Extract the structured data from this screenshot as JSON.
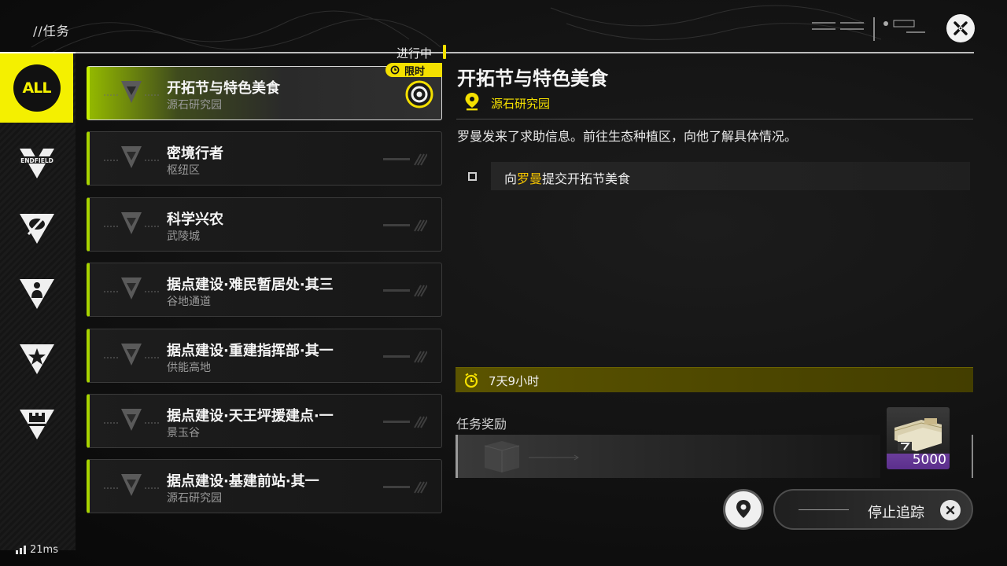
{
  "header": {
    "breadcrumb": "//任务"
  },
  "categories": [
    {
      "label": "ALL",
      "icon": "all-icon",
      "active": true
    },
    {
      "label": "ENDFIELD",
      "icon": "endfield-icon",
      "active": false
    },
    {
      "label": "",
      "icon": "blade-icon",
      "active": false
    },
    {
      "label": "",
      "icon": "person-icon",
      "active": false
    },
    {
      "label": "",
      "icon": "star-icon",
      "active": false
    },
    {
      "label": "",
      "icon": "building-icon",
      "active": false
    }
  ],
  "status": {
    "in_progress": "进行中",
    "limited": "限时"
  },
  "missions": [
    {
      "title": "开拓节与特色美食",
      "region": "源石研究园",
      "active": true
    },
    {
      "title": "密境行者",
      "region": "枢纽区",
      "active": false
    },
    {
      "title": "科学兴农",
      "region": "武陵城",
      "active": false
    },
    {
      "title": "据点建设·难民暂居处·其三",
      "region": "谷地通道",
      "active": false
    },
    {
      "title": "据点建设·重建指挥部·其一",
      "region": "供能高地",
      "active": false
    },
    {
      "title": "据点建设·天王坪援建点·一",
      "region": "景玉谷",
      "active": false
    },
    {
      "title": "据点建设·基建前站·其一",
      "region": "源石研究园",
      "active": false
    }
  ],
  "detail": {
    "title": "开拓节与特色美食",
    "location": "源石研究园",
    "description": "罗曼发来了求助信息。前往生态种植区，向他了解具体情况。",
    "objective": {
      "prefix": "向",
      "highlight": "罗曼",
      "suffix": "提交开拓节美食"
    },
    "time_remaining": "7天9小时",
    "reward_label": "任务奖励",
    "reward_quantity": "5000"
  },
  "controls": {
    "stop_tracking": "停止追踪"
  },
  "network": {
    "ping": "21ms"
  },
  "colors": {
    "accent_yellow": "#f4e000",
    "accent_green": "#a8d400",
    "rarity_purple": "#5b2f8c"
  }
}
